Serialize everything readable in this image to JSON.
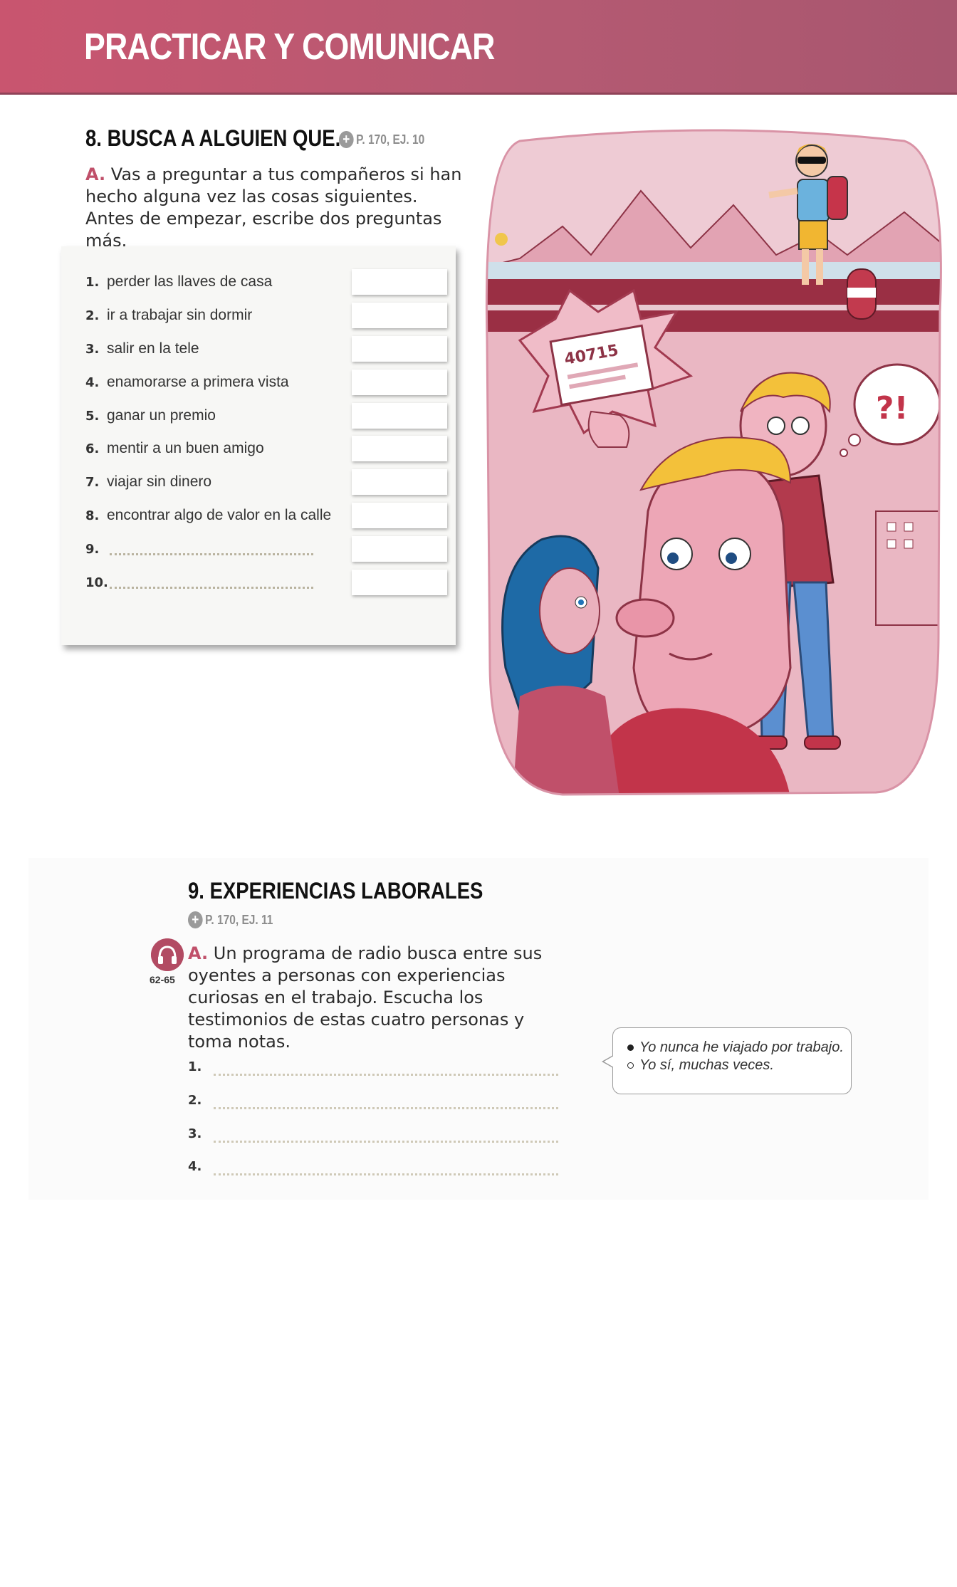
{
  "header": {
    "title": "PRACTICAR Y COMUNICAR"
  },
  "section8": {
    "title": "8. BUSCA A ALGUIEN QUE...",
    "ref": "P. 170, EJ. 10",
    "instruction_letter": "A.",
    "instruction_text": "Vas a preguntar a tus compañeros si han hecho alguna vez las cosas siguientes. Antes de empezar, escribe dos preguntas más.",
    "items": [
      {
        "num": "1.",
        "text": "perder las llaves de casa"
      },
      {
        "num": "2.",
        "text": "ir a trabajar sin dormir"
      },
      {
        "num": "3.",
        "text": "salir en la tele"
      },
      {
        "num": "4.",
        "text": "enamorarse a primera vista"
      },
      {
        "num": "5.",
        "text": "ganar un premio"
      },
      {
        "num": "6.",
        "text": "mentir a un buen amigo"
      },
      {
        "num": "7.",
        "text": "viajar sin dinero"
      },
      {
        "num": "8.",
        "text": "encontrar algo de valor en la calle"
      },
      {
        "num": "9.",
        "text": ""
      },
      {
        "num": "10.",
        "text": ""
      }
    ],
    "illustration": {
      "ticket_number": "40715"
    }
  },
  "section9": {
    "title": "9. EXPERIENCIAS LABORALES",
    "ref": "P. 170, EJ. 11",
    "audio_tracks": "62-65",
    "instruction_letter": "A.",
    "instruction_text": "Un programa de radio busca entre sus oyentes a personas con experiencias curiosas en el trabajo. Escucha los testimonios de estas cuatro personas y toma notas.",
    "lines": [
      "1.",
      "2.",
      "3.",
      "4."
    ],
    "bubble": {
      "line1": "Yo nunca he viajado por trabajo.",
      "line2": "Yo sí, muchas veces."
    }
  },
  "colors": {
    "accent": "#c0506a",
    "header": "#b85a72"
  }
}
